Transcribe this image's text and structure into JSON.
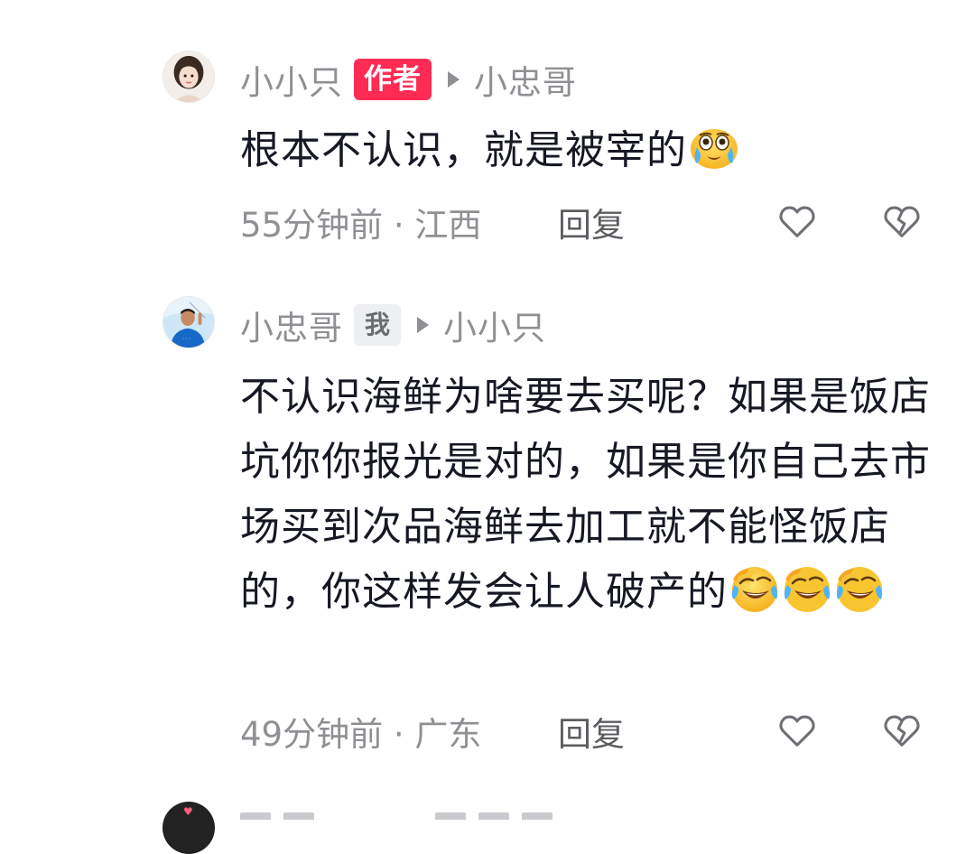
{
  "comments": [
    {
      "username": "小小只",
      "badge": "作者",
      "reply_to": "小忠哥",
      "text": "根本不认识，就是被宰的",
      "emojis": [
        "crying-face-emoji"
      ],
      "time": "55分钟前",
      "location": "江西",
      "reply_label": "回复"
    },
    {
      "username": "小忠哥",
      "badge": "我",
      "reply_to": "小小只",
      "text": "不认识海鲜为啥要去买呢？如果是饭店坑你你报光是对的，如果是你自己去市场买到次品海鲜去加工就不能怪饭店的，你这样发会让人破产的",
      "emojis": [
        "rofl-emoji",
        "rofl-emoji",
        "rofl-emoji"
      ],
      "time": "49分钟前",
      "location": "广东",
      "reply_label": "回复"
    }
  ],
  "separator": " · ",
  "colors": {
    "author_badge": "#fe2c55",
    "me_badge_bg": "#eeeff1",
    "secondary_text": "#8f9094",
    "primary_text": "#161823"
  },
  "icons": {
    "like": "heart-outline-icon",
    "dislike": "broken-heart-icon",
    "reply_arrow": "play-arrow-icon"
  }
}
